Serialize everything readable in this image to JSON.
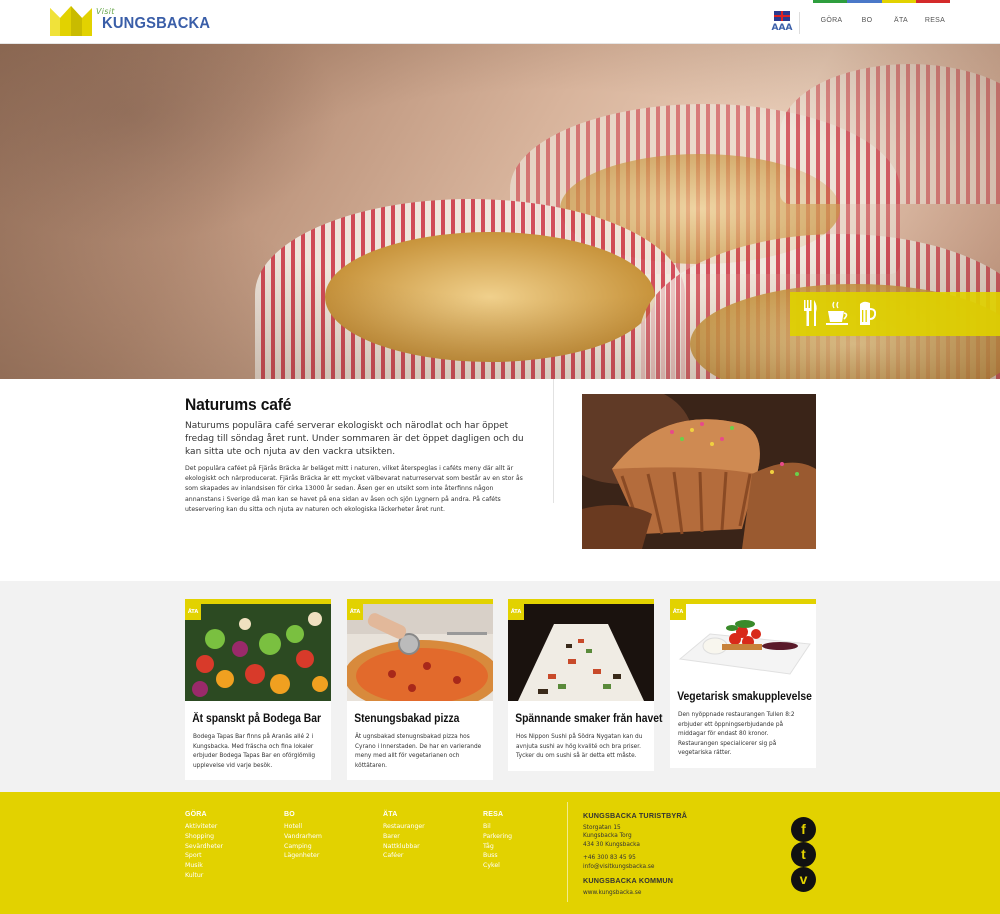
{
  "header": {
    "logo": {
      "visit": "Visit",
      "town": "KUNGSBACKA"
    },
    "lang": {
      "flag": "uk-flag-icon",
      "font_size_label": "AAA"
    },
    "nav": [
      {
        "label": "GÖRA",
        "color": "#2e9e3e"
      },
      {
        "label": "BO",
        "color": "#4a78c8"
      },
      {
        "label": "ÄTA",
        "color": "#e2d200"
      },
      {
        "label": "RESA",
        "color": "#d42a2a"
      }
    ]
  },
  "hero": {
    "icons": [
      "fork-knife-icon",
      "coffee-cup-icon",
      "beer-mug-icon"
    ],
    "icon_bar_color": "#e2d200"
  },
  "intro": {
    "title": "Naturums café",
    "lead": "Naturums populära café serverar ekologiskt och närodlat och har öppet fredag till söndag året runt. Under sommaren är det öppet dagligen och du kan sitta ute och njuta av den vackra utsikten.",
    "body": "Det populära caféet på Fjärås Bräcka är beläget mitt i naturen, vilket återspeglas i caféts meny där allt är ekologiskt och närproducerat. Fjärås Bräcka är ett mycket välbevarat naturreservat som består av en stor ås som skapades av inlandsisen för cirka 13000 år sedan. Åsen ger en utsikt som inte återfinns någon annanstans i Sverige då man kan se havet på ena sidan av åsen och sjön Lygnern på andra. På caféts uteservering kan du sitta och njuta av naturen och ekologiska läckerheter året runt."
  },
  "cards": [
    {
      "tag": "ÄTA",
      "title": "Ät spanskt på Bodega Bar",
      "text": "Bodega Tapas Bar finns på Aranäs allé 2 i Kungsbacka. Med fräscha och fina lokaler erbjuder Bodega Tapas Bar en oförglömlig upplevelse vid varje besök."
    },
    {
      "tag": "ÄTA",
      "title": "Stenungsbakad pizza",
      "text": "Ät ugnsbakad stenugnsbakad pizza hos Cyrano i Innerstaden. De har en varierande meny med allt för vegetarianen och köttätaren."
    },
    {
      "tag": "ÄTA",
      "title": "Spännande smaker från havet",
      "text": "Hos Nippon Sushi på Södra Nygatan kan du avnjuta sushi av hög kvalité och bra priser. Tycker du om sushi så är detta ett måste."
    },
    {
      "tag": "ÄTA",
      "title": "Vegetarisk smakupplevelse",
      "text": "Den nyöppnade restaurangen Tullen 8:2 erbjuder ett öppningserbjudande på middagar för endast 80 kronor. Restaurangen specialicerer sig på vegetariska rätter."
    }
  ],
  "footer": {
    "columns": [
      {
        "heading": "GÖRA",
        "links": [
          "Aktiviteter",
          "Shopping",
          "Sevärdheter",
          "Sport",
          "Musik",
          "Kultur"
        ]
      },
      {
        "heading": "BO",
        "links": [
          "Hotell",
          "Vandrarhem",
          "Camping",
          "Lägenheter"
        ]
      },
      {
        "heading": "ÄTA",
        "links": [
          "Restauranger",
          "Barer",
          "Nattklubbar",
          "Caféer"
        ]
      },
      {
        "heading": "RESA",
        "links": [
          "Bil",
          "Parkering",
          "Tåg",
          "Buss",
          "Cykel"
        ]
      }
    ],
    "tourist_office": {
      "heading": "KUNGSBACKA TURISTBYRÅ",
      "street": "Storgatan 15",
      "square": "Kungsbacka Torg",
      "postal": "434 30 Kungsbacka",
      "phone": "+46 300 83 45 95",
      "email": "info@visitkungsbacka.se"
    },
    "municipality": {
      "heading": "KUNGSBACKA KOMMUN",
      "url": "www.kungsbacka.se"
    },
    "social": [
      {
        "icon": "facebook-icon",
        "glyph": "f"
      },
      {
        "icon": "twitter-icon",
        "glyph": "t"
      },
      {
        "icon": "vimeo-icon",
        "glyph": "v"
      }
    ]
  }
}
